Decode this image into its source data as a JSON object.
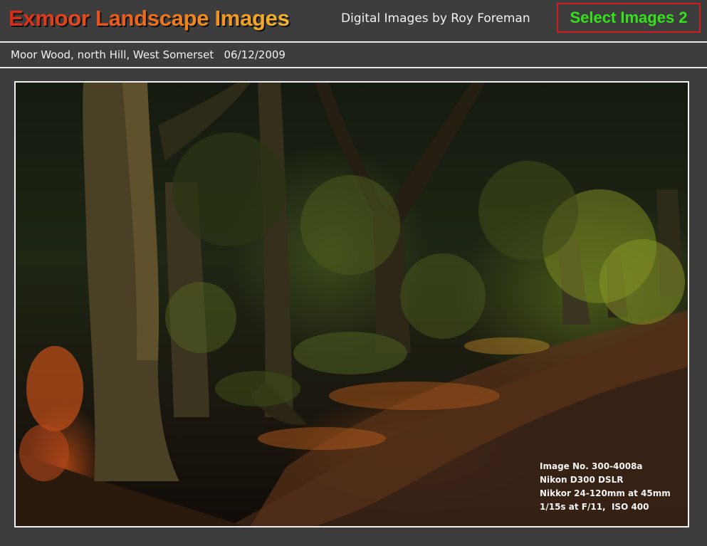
{
  "header": {
    "site_title": "Exmoor Landscape Images",
    "byline": "Digital Images by Roy Foreman",
    "select_button_label": "Select Images 2"
  },
  "caption": {
    "location": "Moor Wood, north Hill, West Somerset",
    "date": "06/12/2009"
  },
  "photo": {
    "alt": "Moor Wood, north Hill, West Somerset",
    "exif": [
      "Image No. 300-4008a",
      "Nikon D300 DSLR",
      "Nikkor 24-120mm at 45mm",
      "1/15s at F/11,  ISO 400"
    ]
  },
  "colors": {
    "background": "#3d3d3d",
    "select_button_text": "#33e21a",
    "select_button_border": "#d21c1c",
    "title_gradient_start": "#d82a17",
    "title_gradient_end": "#f2b62d"
  }
}
